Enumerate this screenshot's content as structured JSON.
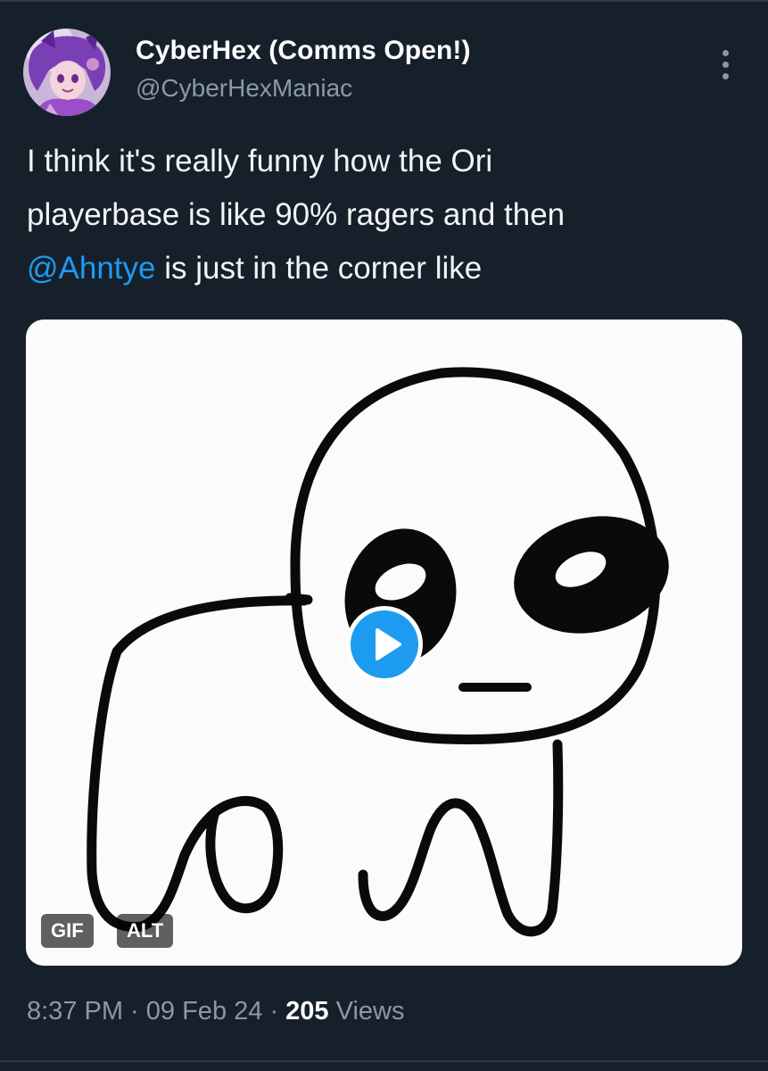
{
  "author": {
    "display_name": "CyberHex (Comms Open!)",
    "handle": "@CyberHexManiac",
    "avatar_icon": "user-avatar"
  },
  "tweet": {
    "text_line_1": "I think it's really funny how the Ori",
    "text_line_2": "playerbase is like 90% ragers and then",
    "mention": "@Ahntye",
    "text_line_3_rest": " is just in the corner like"
  },
  "media": {
    "type_badge": "GIF",
    "alt_badge": "ALT",
    "play_icon": "play-icon"
  },
  "meta": {
    "time": "8:37 PM",
    "separator": " · ",
    "date": "09 Feb 24",
    "views_count": "205",
    "views_label": " Views"
  },
  "colors": {
    "background": "#16202b",
    "accent": "#1d9bf0",
    "secondary_text": "#8b98a5"
  }
}
